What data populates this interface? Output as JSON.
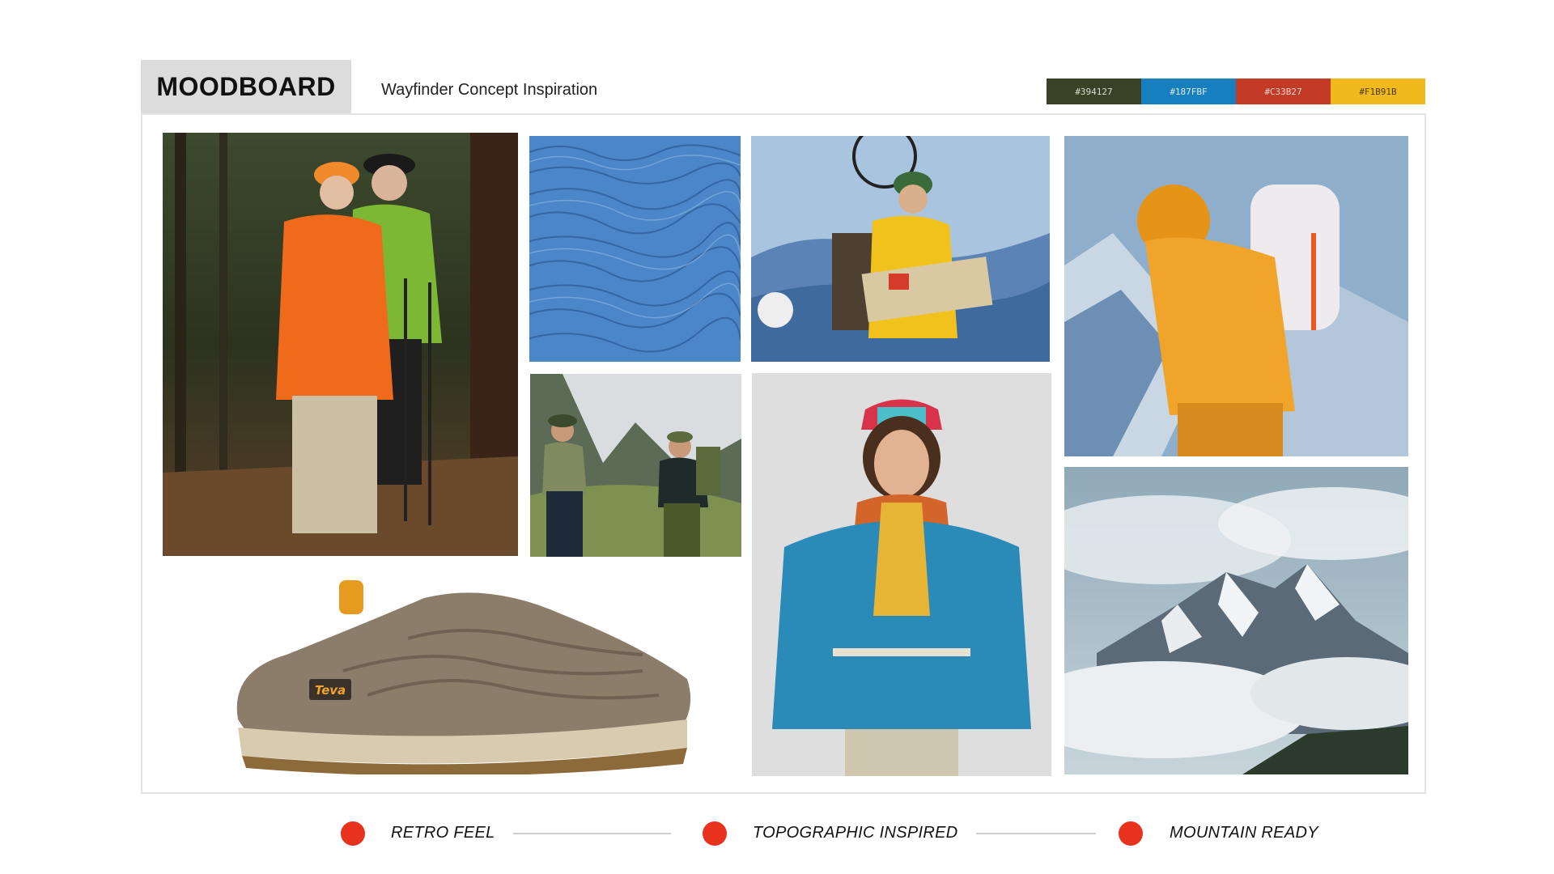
{
  "header": {
    "title": "MOODBOARD",
    "subtitle": "Wayfinder Concept Inspiration"
  },
  "palette": [
    {
      "hex_label": "#394127",
      "color": "#394127"
    },
    {
      "hex_label": "#187FBF",
      "color": "#187FBF"
    },
    {
      "hex_label": "#C33B27",
      "color": "#C33B27"
    },
    {
      "hex_label": "#F1B91B",
      "color": "#F1B91B"
    }
  ],
  "images": {
    "product_logo_text": "Teva"
  },
  "keywords": [
    {
      "label": "RETRO FEEL"
    },
    {
      "label": "TOPOGRAPHIC INSPIRED"
    },
    {
      "label": "MOUNTAIN READY"
    }
  ],
  "colors": {
    "accent_dot": "#E8321E",
    "tab_bg": "#DCDCDC",
    "divider": "#CFCFCF"
  }
}
